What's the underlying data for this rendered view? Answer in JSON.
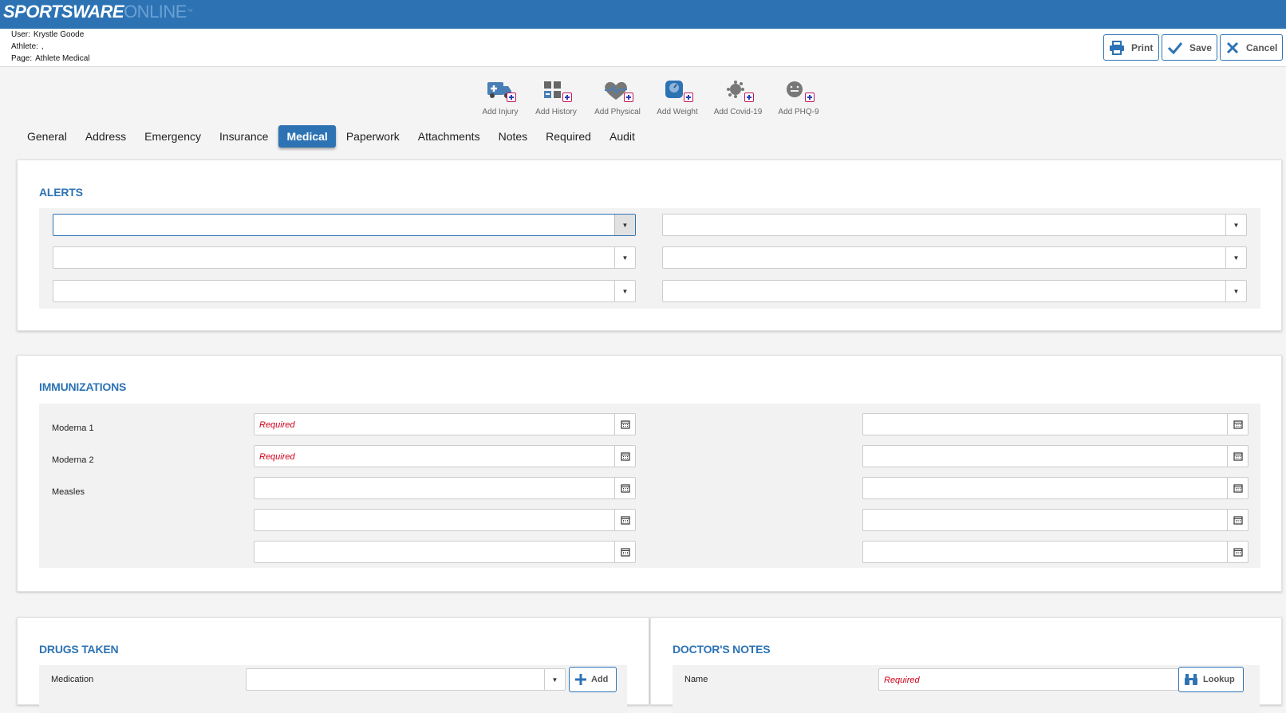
{
  "brand": {
    "bold": "SPORTSWARE",
    "light": "ONLINE",
    "tm": "™"
  },
  "info": {
    "user_label": "User:",
    "user": "Krystle Goode",
    "athlete_label": "Athlete:",
    "athlete": ",",
    "page_label": "Page:",
    "page": "Athlete Medical"
  },
  "header_buttons": {
    "print": "Print",
    "save": "Save",
    "cancel": "Cancel"
  },
  "quick_actions": [
    {
      "label": "Add Injury",
      "icon": "ambulance-icon"
    },
    {
      "label": "Add History",
      "icon": "history-grid-icon"
    },
    {
      "label": "Add Physical",
      "icon": "heart-pulse-icon"
    },
    {
      "label": "Add Weight",
      "icon": "scale-icon"
    },
    {
      "label": "Add Covid-19",
      "icon": "virus-icon"
    },
    {
      "label": "Add PHQ-9",
      "icon": "face-icon"
    }
  ],
  "tabs": [
    "General",
    "Address",
    "Emergency",
    "Insurance",
    "Medical",
    "Paperwork",
    "Attachments",
    "Notes",
    "Required",
    "Audit"
  ],
  "active_tab": "Medical",
  "alerts": {
    "title": "ALERTS"
  },
  "immunizations": {
    "title": "IMMUNIZATIONS",
    "rows": [
      {
        "label": "Moderna 1",
        "left_placeholder": "Required"
      },
      {
        "label": "Moderna 2",
        "left_placeholder": "Required"
      },
      {
        "label": "Measles",
        "left_placeholder": ""
      },
      {
        "label": "",
        "left_placeholder": ""
      },
      {
        "label": "",
        "left_placeholder": ""
      }
    ]
  },
  "drugs": {
    "title": "DRUGS TAKEN",
    "medication_label": "Medication",
    "add_label": "Add"
  },
  "doctor": {
    "title": "DOCTOR'S NOTES",
    "name_label": "Name",
    "name_placeholder": "Required",
    "lookup_label": "Lookup"
  },
  "colors": {
    "brand_blue": "#2d73b4",
    "required_red": "#d0021b",
    "accent_plus": "#c2185b"
  }
}
